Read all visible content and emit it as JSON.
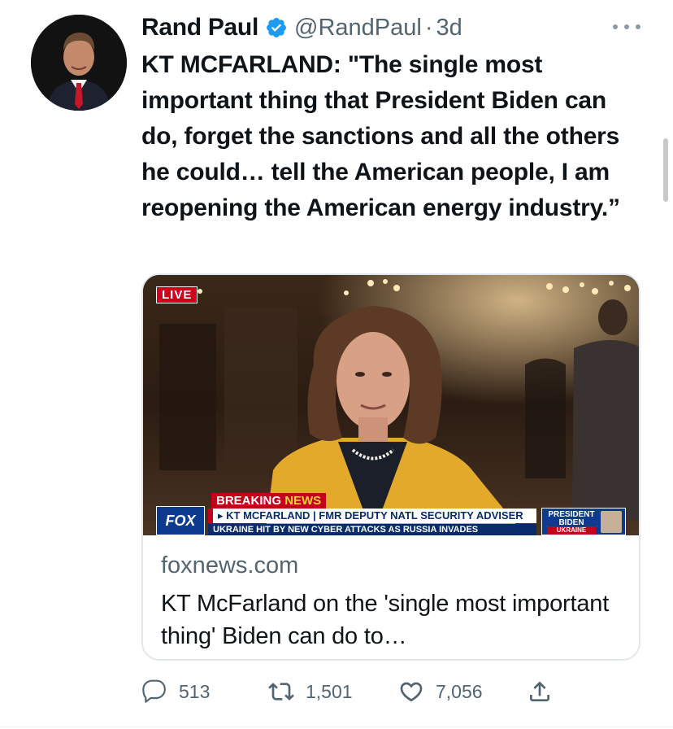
{
  "author": {
    "name": "Rand Paul",
    "handle": "@RandPaul",
    "separator": "·",
    "time": "3d",
    "verified": true
  },
  "tweet": {
    "text": "KT MCFARLAND: \"The single most important thing that President Biden can do, forget the sanctions and all the others he could… tell the American people, I am reopening the American energy industry.”"
  },
  "media": {
    "live_badge": "LIVE",
    "breaking_prefix": "BREAKING",
    "breaking_suffix": "NEWS",
    "lower_third": "▸ KT MCFARLAND | FMR DEPUTY NATL SECURITY ADVISER",
    "ticker": "UKRAINE HIT BY NEW CYBER ATTACKS AS RUSSIA INVADES",
    "network_logo": "FOX",
    "side_tag_line1": "PRESIDENT",
    "side_tag_line2": "BIDEN",
    "side_tag_sub": "UKRAINE"
  },
  "link_card": {
    "domain": "foxnews.com",
    "title": "KT McFarland on the 'single most important thing' Biden can do to…"
  },
  "actions": {
    "replies": "513",
    "retweets": "1,501",
    "likes": "7,056"
  },
  "icons": {
    "verified": "verified-badge-icon",
    "more": "more-icon",
    "reply": "reply-icon",
    "retweet": "retweet-icon",
    "like": "like-icon",
    "share": "share-icon"
  },
  "colors": {
    "verified_blue": "#1d9bf0",
    "text_primary": "#0f1419",
    "text_secondary": "#536471",
    "icon_gray": "#536471",
    "border": "#e1e8ed"
  }
}
